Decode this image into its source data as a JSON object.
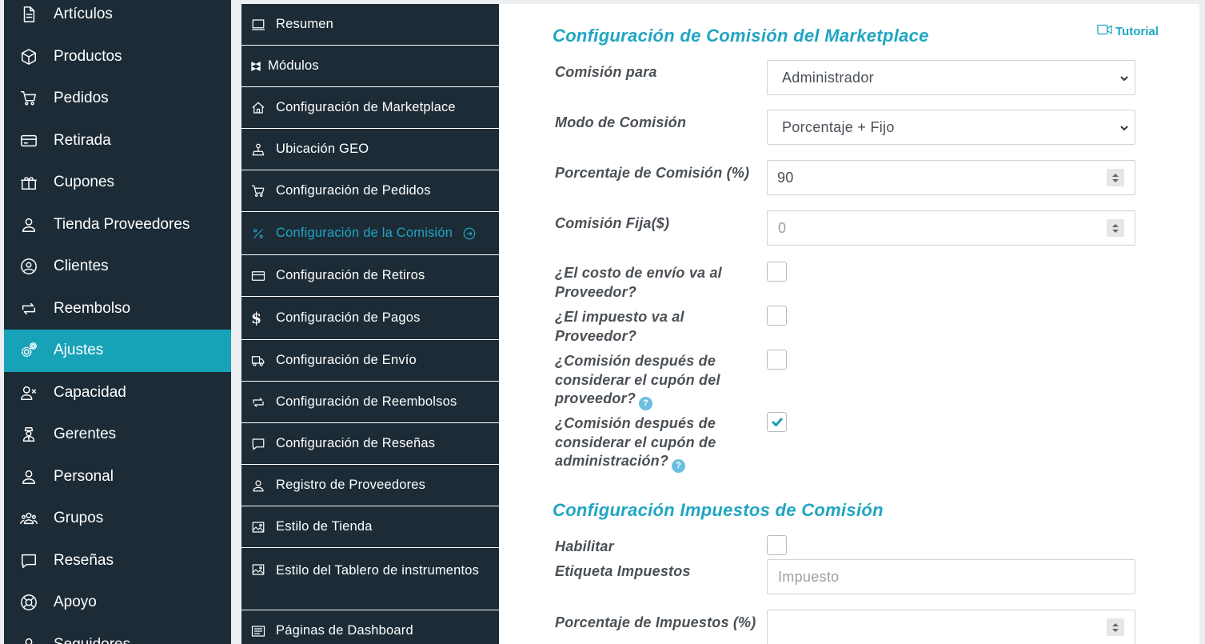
{
  "main_sidebar": {
    "items": [
      {
        "label": "Artículos",
        "icon": "document-icon"
      },
      {
        "label": "Productos",
        "icon": "cube-icon"
      },
      {
        "label": "Pedidos",
        "icon": "cart-icon"
      },
      {
        "label": "Retirada",
        "icon": "card-icon"
      },
      {
        "label": "Cupones",
        "icon": "gift-icon"
      },
      {
        "label": "Tienda Proveedores",
        "icon": "user-icon"
      },
      {
        "label": "Clientes",
        "icon": "user-circle-icon"
      },
      {
        "label": "Reembolso",
        "icon": "refund-icon"
      },
      {
        "label": "Ajustes",
        "icon": "gears-icon",
        "active": true
      },
      {
        "label": "Capacidad",
        "icon": "user-x-icon"
      },
      {
        "label": "Gerentes",
        "icon": "manager-icon"
      },
      {
        "label": "Personal",
        "icon": "user-icon"
      },
      {
        "label": "Grupos",
        "icon": "users-icon"
      },
      {
        "label": "Reseñas",
        "icon": "comment-icon"
      },
      {
        "label": "Apoyo",
        "icon": "lifebuoy-icon"
      },
      {
        "label": "Seguidores",
        "icon": "followers-icon"
      }
    ]
  },
  "settings_menu": {
    "items": [
      {
        "label": "Resumen",
        "icon": "monitor-icon"
      },
      {
        "label": "Módulos",
        "icon": "modules-icon"
      },
      {
        "label": "Configuración de Marketplace",
        "icon": "home-icon"
      },
      {
        "label": "Ubicación GEO",
        "icon": "geo-icon"
      },
      {
        "label": "Configuración de Pedidos",
        "icon": "cart-icon"
      },
      {
        "label": "Configuración de la Comisión",
        "icon": "percent-icon",
        "active": true
      },
      {
        "label": "Configuración de Retiros",
        "icon": "card-icon"
      },
      {
        "label": "Configuración de Pagos",
        "icon": "dollar-icon"
      },
      {
        "label": "Configuración de Envío",
        "icon": "truck-icon"
      },
      {
        "label": "Configuración de Reembolsos",
        "icon": "refund-icon"
      },
      {
        "label": "Configuración de Reseñas",
        "icon": "comment-icon"
      },
      {
        "label": "Registro de Proveedores",
        "icon": "user-icon"
      },
      {
        "label": "Estilo de Tienda",
        "icon": "image-icon"
      },
      {
        "label": "Estilo del Tablero de instrumentos",
        "icon": "image-icon"
      },
      {
        "label": "Páginas de Dashboard",
        "icon": "pages-icon"
      }
    ]
  },
  "content": {
    "tutorial_label": "Tutorial",
    "commission_section": {
      "title": "Configuración de Comisión del Marketplace",
      "commission_for": {
        "label": "Comisión para",
        "value": "Administrador"
      },
      "commission_mode": {
        "label": "Modo de Comisión",
        "value": "Porcentaje + Fijo"
      },
      "commission_percent": {
        "label": "Porcentaje de Comisión (%)",
        "value": "90"
      },
      "commission_fixed": {
        "label": "Comisión Fija($)",
        "value": "0"
      },
      "shipping_to_vendor": {
        "label": "¿El costo de envío va al Proveedor?",
        "checked": false
      },
      "tax_to_vendor": {
        "label": "¿El impuesto va al Proveedor?",
        "checked": false
      },
      "after_vendor_coupon": {
        "label": "¿Comisión después de considerar el cupón del proveedor?",
        "checked": false
      },
      "after_admin_coupon": {
        "label": "¿Comisión después de considerar el cupón de administración?",
        "checked": true
      }
    },
    "tax_section": {
      "title": "Configuración Impuestos de Comisión",
      "enable": {
        "label": "Habilitar",
        "checked": false
      },
      "tax_label": {
        "label": "Etiqueta Impuestos",
        "placeholder": "Impuesto"
      },
      "tax_percent": {
        "label": "Porcentaje de Impuestos (%)",
        "value": ""
      }
    }
  },
  "colors": {
    "sidebar_bg": "#1c2b36",
    "accent": "#17a2b8",
    "title": "#20a5c3"
  }
}
